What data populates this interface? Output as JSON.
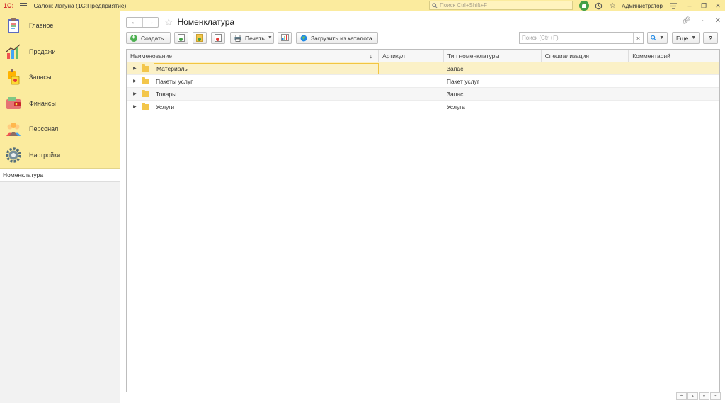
{
  "app": {
    "logo": "1С:",
    "title": "Салон: Лагуна  (1С:Предприятие)",
    "search_placeholder": "Поиск Ctrl+Shift+F",
    "user": "Администратор"
  },
  "sidebar": {
    "sections": [
      {
        "label": "Главное",
        "icon": "clipboard-icon"
      },
      {
        "label": "Продажи",
        "icon": "sales-chart-icon"
      },
      {
        "label": "Запасы",
        "icon": "stock-icon"
      },
      {
        "label": "Финансы",
        "icon": "wallet-icon"
      },
      {
        "label": "Персонал",
        "icon": "staff-icon"
      },
      {
        "label": "Настройки",
        "icon": "gear-icon"
      }
    ],
    "open_windows": [
      "Номенклатура"
    ]
  },
  "form": {
    "title": "Номенклатура",
    "toolbar": {
      "create": "Создать",
      "print": "Печать",
      "load_catalog": "Загрузить из каталога",
      "search_placeholder": "Поиск (Ctrl+F)",
      "more": "Еще",
      "help": "?"
    },
    "columns": [
      "Наименование",
      "Артикул",
      "Тип номенклатуры",
      "Специализация",
      "Комментарий"
    ],
    "rows": [
      {
        "name": "Материалы",
        "article": "",
        "type": "Запас",
        "spec": "",
        "comment": ""
      },
      {
        "name": "Пакеты услуг",
        "article": "",
        "type": "Пакет услуг",
        "spec": "",
        "comment": ""
      },
      {
        "name": "Товары",
        "article": "",
        "type": "Запас",
        "spec": "",
        "comment": ""
      },
      {
        "name": "Услуги",
        "article": "",
        "type": "Услуга",
        "spec": "",
        "comment": ""
      }
    ]
  },
  "colors": {
    "accent": "#fbeb9e",
    "selected_row": "#fbf1c7",
    "focus_border": "#f2c542",
    "create_icon": "#4caf50",
    "folder": "#f3c64b"
  }
}
